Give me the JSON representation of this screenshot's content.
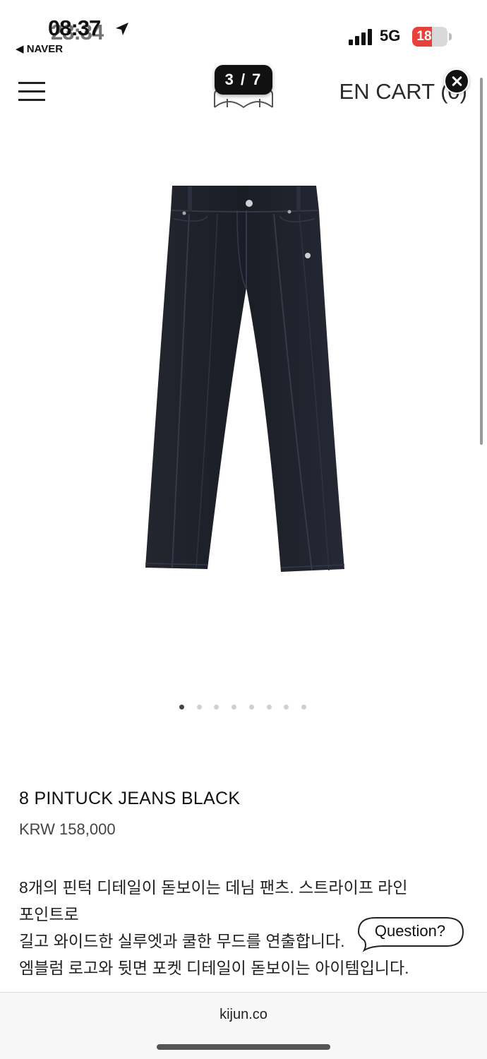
{
  "status_bar": {
    "time": "08:37",
    "time_overlay": "23:34",
    "back_label": "◀ NAVER",
    "network": "5G",
    "battery_level": "18",
    "battery_fraction": 0.18,
    "location_icon": "location-arrow-icon",
    "signal_icon": "signal-bars-icon"
  },
  "header": {
    "menu_icon": "hamburger-menu-icon",
    "logo_icon": "brand-logo-icon",
    "page_counter": "3 / 7",
    "language": "EN",
    "cart_label": "CART (0)",
    "close_icon": "close-icon"
  },
  "gallery": {
    "image_icon": "jeans-product-image",
    "dot_count": 8,
    "active_index": 0
  },
  "product": {
    "name": "8 PINTUCK JEANS BLACK",
    "price": "KRW 158,000",
    "description": [
      "8개의 핀턱 디테일이 돋보이는 데님 팬츠. 스트라이프 라인",
      "포인트로",
      "길고 와이드한 실루엣과 쿨한 무드를 연출합니다.",
      "엠블럼 로고와 뒷면 포켓 디테일이 돋보이는 아이템입니다."
    ]
  },
  "question_button": {
    "label": "Question?"
  },
  "browser": {
    "domain": "kijun.co"
  },
  "colors": {
    "background": "#ffffff",
    "text": "#222222",
    "denim": "#1f2230",
    "battery": "#e8413b"
  }
}
